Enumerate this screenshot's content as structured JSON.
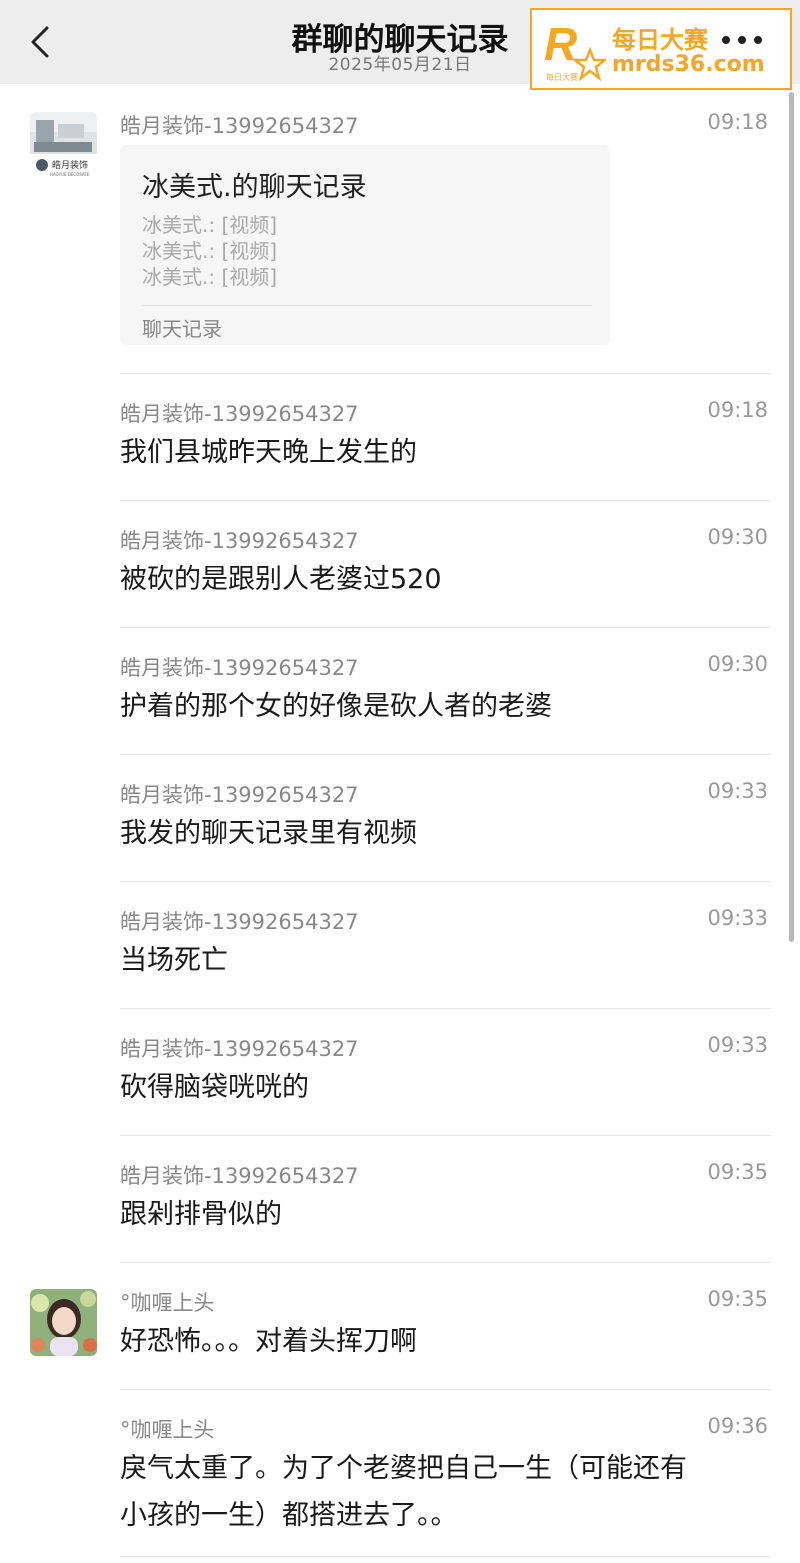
{
  "header": {
    "title": "群聊的聊天记录",
    "date": "2025年05月21日",
    "back_icon": "chevron-left-icon",
    "more_icon": "more-dots-icon"
  },
  "watermark": {
    "logo_letter": "R",
    "logo_small": "每日大赛",
    "line1": "每日大赛",
    "line2": "mrds36.com",
    "color": "#f5a623"
  },
  "messages": [
    {
      "sender": "皓月装饰-13992654327",
      "time": "09:18",
      "avatar": {
        "label": "皓月装饰",
        "sub": "HAOYUE DECORATE"
      },
      "record": {
        "title": "冰美式.的聊天记录",
        "lines": [
          "冰美式.: [视频]",
          "冰美式.: [视频]",
          "冰美式.: [视频]"
        ],
        "label": "聊天记录"
      }
    },
    {
      "sender": "皓月装饰-13992654327",
      "time": "09:18",
      "text": "我们县城昨天晚上发生的"
    },
    {
      "sender": "皓月装饰-13992654327",
      "time": "09:30",
      "text": "被砍的是跟别人老婆过520"
    },
    {
      "sender": "皓月装饰-13992654327",
      "time": "09:30",
      "text": "护着的那个女的好像是砍人者的老婆"
    },
    {
      "sender": "皓月装饰-13992654327",
      "time": "09:33",
      "text": "我发的聊天记录里有视频"
    },
    {
      "sender": "皓月装饰-13992654327",
      "time": "09:33",
      "text": "当场死亡"
    },
    {
      "sender": "皓月装饰-13992654327",
      "time": "09:33",
      "text": "砍得脑袋咣咣的"
    },
    {
      "sender": "皓月装饰-13992654327",
      "time": "09:35",
      "text": "跟剁排骨似的"
    },
    {
      "sender": "°咖喱上头",
      "time": "09:35",
      "text": "好恐怖。。。对着头挥刀啊"
    },
    {
      "sender": "°咖喱上头",
      "time": "09:36",
      "text_lines": [
        "戾气太重了。为了个老婆把自己一生（可能还有",
        "小孩的一生）都搭进去了。。"
      ]
    }
  ]
}
